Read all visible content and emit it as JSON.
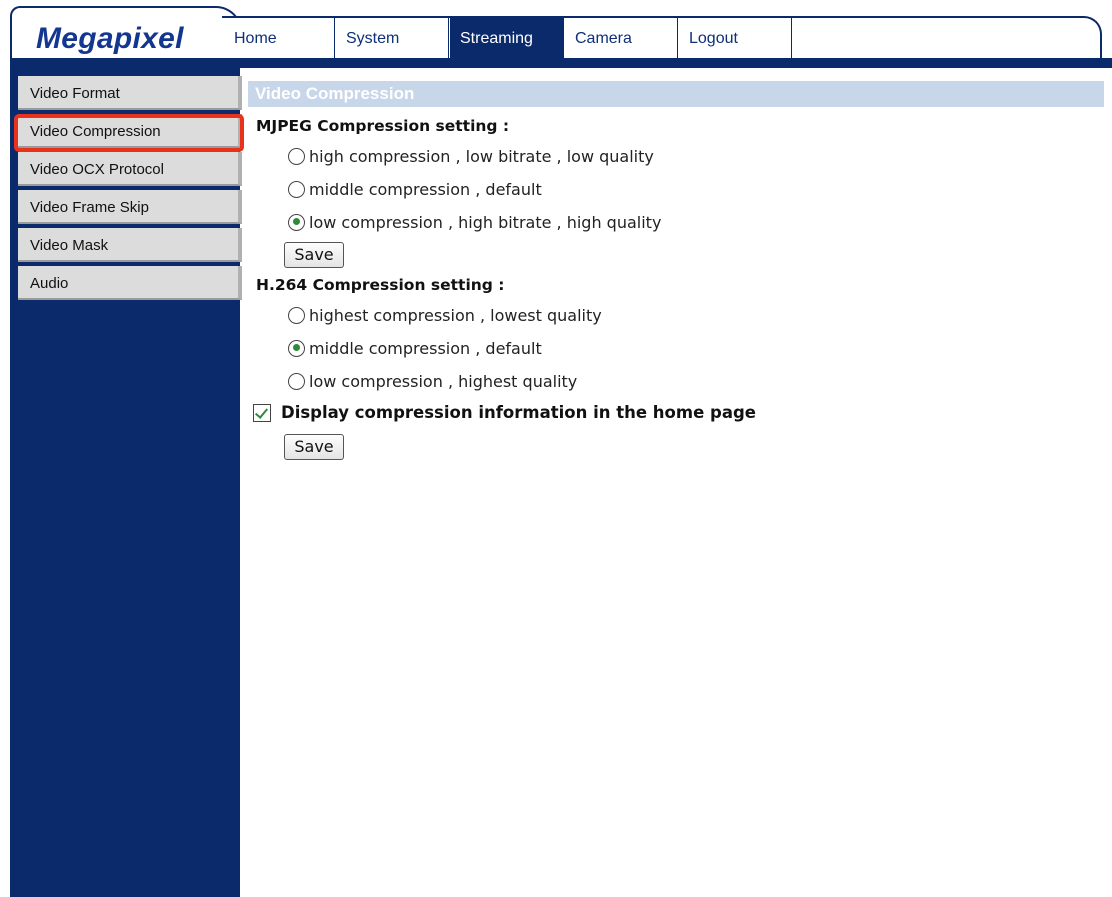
{
  "brand": {
    "logo": "Megapixel"
  },
  "nav": {
    "home": "Home",
    "system": "System",
    "streaming": "Streaming",
    "camera": "Camera",
    "logout": "Logout",
    "active": "Streaming"
  },
  "sidebar": {
    "items": [
      {
        "label": "Video Format"
      },
      {
        "label": "Video Compression"
      },
      {
        "label": "Video OCX Protocol"
      },
      {
        "label": "Video Frame Skip"
      },
      {
        "label": "Video Mask"
      },
      {
        "label": "Audio"
      }
    ],
    "highlighted": "Video Compression"
  },
  "main": {
    "section_title": "Video Compression",
    "mjpeg": {
      "heading": "MJPEG Compression setting :",
      "options": [
        {
          "label": "high compression , low bitrate , low quality",
          "checked": false
        },
        {
          "label": "middle compression , default",
          "checked": false
        },
        {
          "label": "low compression , high bitrate , high quality",
          "checked": true
        }
      ],
      "save_label": "Save"
    },
    "h264": {
      "heading": "H.264 Compression setting :",
      "options": [
        {
          "label": "highest compression , lowest quality",
          "checked": false
        },
        {
          "label": "middle compression , default",
          "checked": true
        },
        {
          "label": "low compression , highest quality",
          "checked": false
        }
      ],
      "display_info_label": "Display compression information in the home page",
      "display_info_checked": true,
      "save_label": "Save"
    }
  },
  "colors": {
    "nav_dark": "#0b2a6b",
    "logo_blue": "#13368f",
    "title_bar": "#c8d6ea",
    "highlight": "#e8321c",
    "radio_check": "#2e8b3a"
  }
}
